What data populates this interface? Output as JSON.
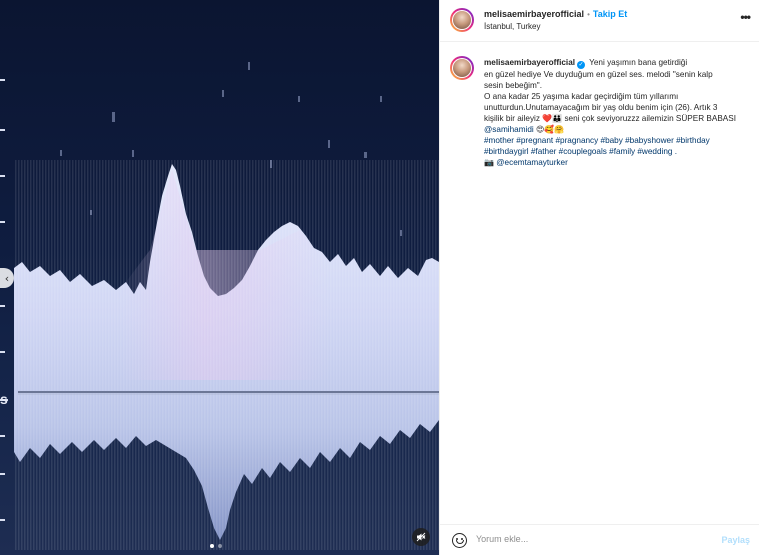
{
  "media": {
    "prev_icon": "chevron-left-icon",
    "mute_icon": "speaker-muted-icon",
    "carousel": {
      "count": 2,
      "active_index": 0
    }
  },
  "header": {
    "username": "melisaemirbayerofficial",
    "separator": "•",
    "follow_label": "Takip Et",
    "location": "İstanbul, Turkey",
    "more_icon": "•••"
  },
  "caption": {
    "username": "melisaemirbayerofficial",
    "verified_mark": "✓",
    "line1": "Yeni yaşımın bana getirdiği",
    "line2": "en güzel hediye Ve duyduğum en güzel ses. melodi \"senin kalp",
    "line3": "sesin bebeğim\".",
    "line4": "O ana kadar 25 yaşıma kadar geçirdiğim tüm yıllarımı",
    "line5": "unutturdun.Unutamayacağım bir yaş oldu benim için (26). Artık 3",
    "line6a": "kişilik bir aileyiz",
    "line6_emoji": "❤️👪",
    "line6b": "seni çok seviyoruzzz ailemizin SÜPER BABASI",
    "mention_line": "@samihamidi",
    "mention_emoji": "😍🥰🤗",
    "hashtags1": "#mother #pregnant #pragnancy #baby #babyshower #birthday",
    "hashtags2": "#birthdaygirl #father #couplegoals #family #wedding .",
    "credit_emoji": "📷",
    "credit": "@ecemtamayturker"
  },
  "footer": {
    "emoji_icon": "smile-icon",
    "comment_placeholder": "Yorum ekle...",
    "post_label": "Paylaş"
  },
  "colors": {
    "accent": "#0095f6",
    "link": "#00376b",
    "post_disabled": "#b2dffc",
    "media_bg": "#0f1d40",
    "wave": "#c9d4f0"
  }
}
